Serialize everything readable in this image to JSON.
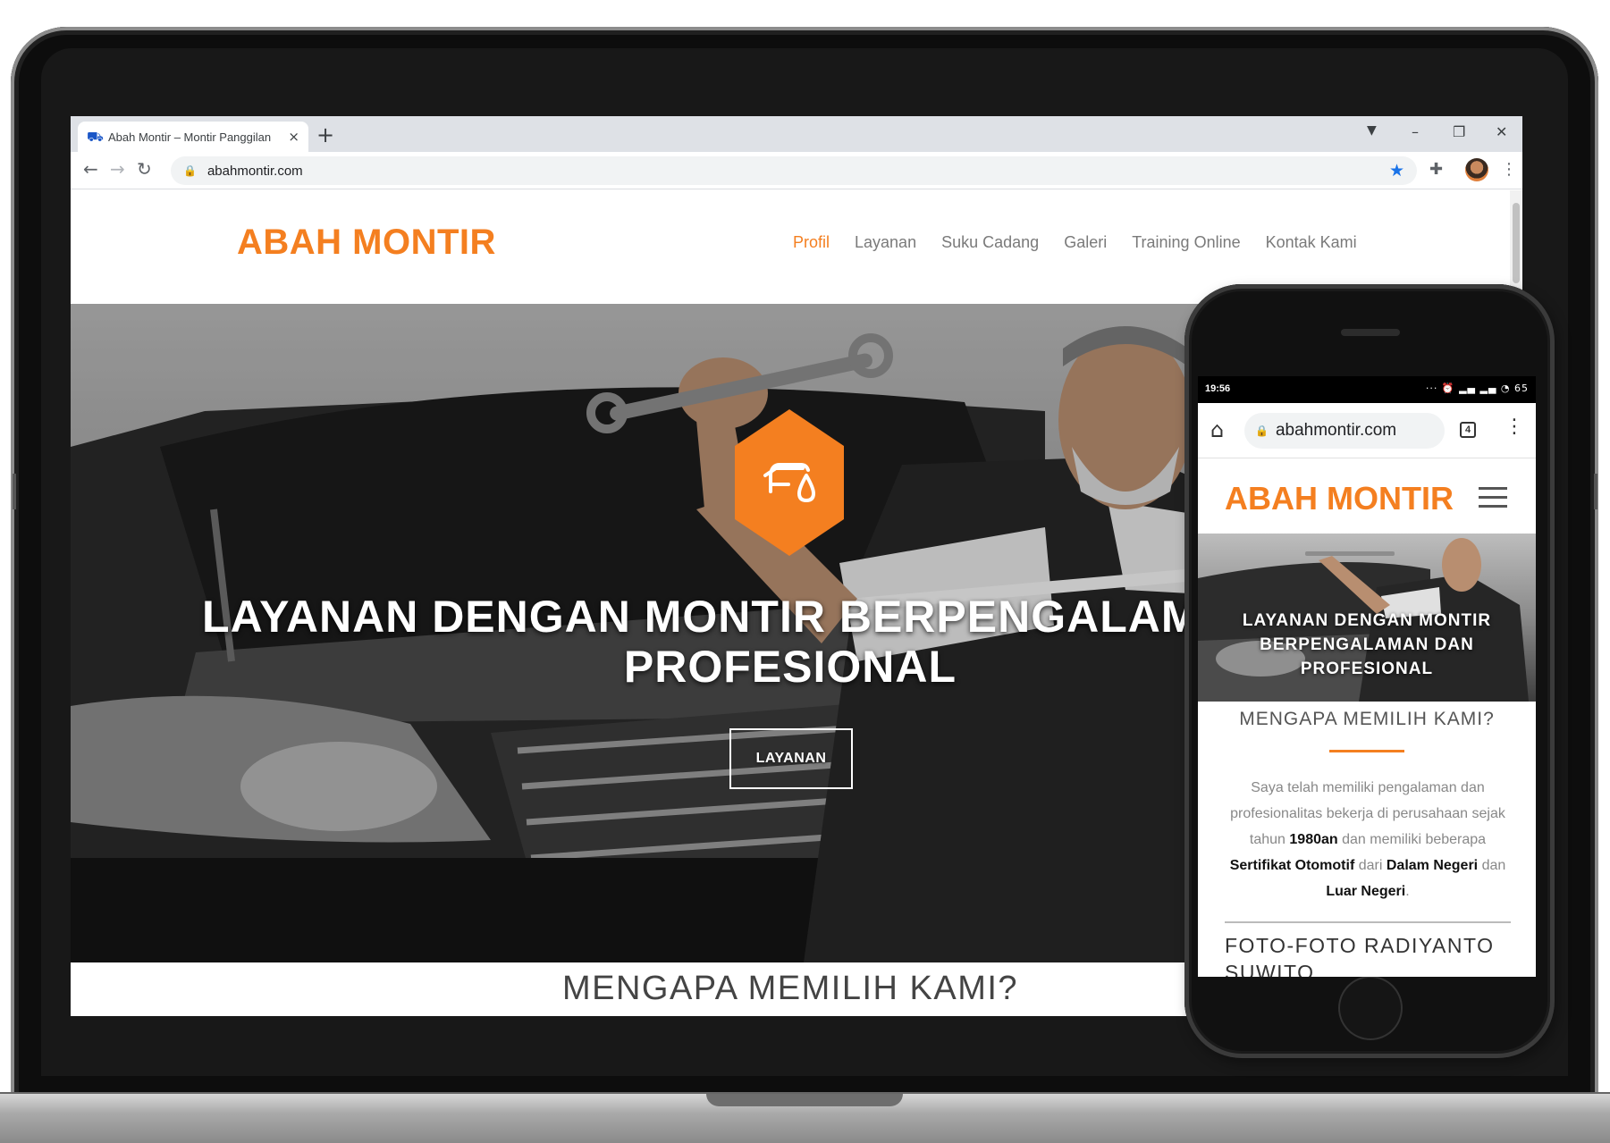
{
  "browser": {
    "tab_title": "Abah Montir – Montir Panggilan",
    "tab_favicon": "car-lift-icon",
    "tab_close": "×",
    "new_tab": "+",
    "url": "abahmontir.com",
    "window_controls": {
      "minimize": "–",
      "maximize": "❐",
      "close": "✕"
    }
  },
  "site": {
    "logo": "ABAH MONTIR",
    "nav": [
      "Profil",
      "Layanan",
      "Suku Cadang",
      "Galeri",
      "Training Online",
      "Kontak Kami"
    ],
    "active_nav": "Profil",
    "hero_title": "LAYANAN DENGAN MONTIR BERPENGALAMAN DAN PROFESIONAL",
    "hero_button": "LAYANAN",
    "hero_icon": "car-oil-icon",
    "section_title": "MENGAPA MEMILIH KAMI?"
  },
  "mobile": {
    "status_time": "19:56",
    "status_icons": "··· ⏰ ▂▄ ▂▄ ◔ 65",
    "url": "abahmontir.com",
    "tab_count": "4",
    "logo": "ABAH MONTIR",
    "hero_title": "LAYANAN DENGAN MONTIR BERPENGALAMAN DAN PROFESIONAL",
    "section_title": "MENGAPA MEMILIH KAMI?",
    "body": {
      "p1": "Saya telah memiliki pengalaman dan profesionalitas bekerja di perusahaan sejak tahun ",
      "b1": "1980an",
      "p2": " dan memiliki  beberapa ",
      "b2": "Sertifikat Otomotif",
      "p3": " dari ",
      "b3": "Dalam Negeri",
      "p4": " dan ",
      "b4": "Luar Negeri",
      "p5": "."
    },
    "foto_heading": "FOTO-FOTO RADIYANTO SUWITO"
  },
  "colors": {
    "accent": "#f47f20",
    "nav_text": "#7a7a7a",
    "link_blue": "#1a73e8"
  }
}
